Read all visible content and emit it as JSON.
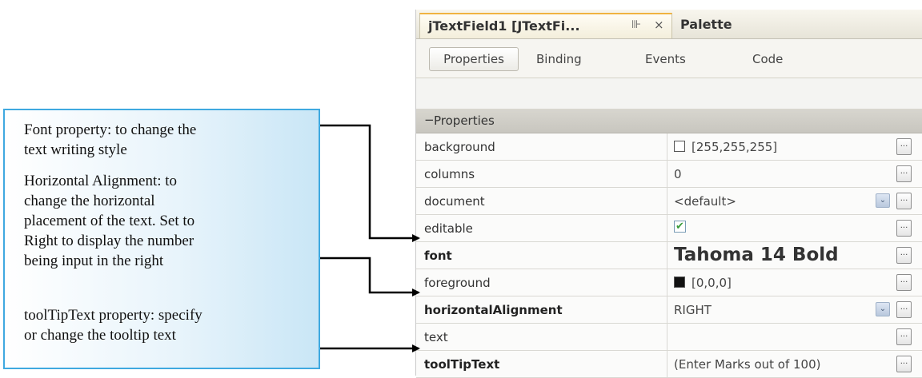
{
  "callout": {
    "p1_l1": "Font property: to change the",
    "p1_l2": "text writing style",
    "p2_l1": "Horizontal Alignment: to",
    "p2_l2": "change the horizontal",
    "p2_l3": "placement of the text. Set to",
    "p2_l4": "Right to display the number",
    "p2_l5": "being input in the right",
    "p3_l1": "toolTipText property: specify",
    "p3_l2": "or change the tooltip text"
  },
  "tabbar": {
    "active_title": "jTextField1 [JTextFi...",
    "pin_icon": "⊪",
    "close_icon": "×",
    "palette_label": "Palette"
  },
  "subtabs": {
    "properties": "Properties",
    "binding": "Binding",
    "events": "Events",
    "code": "Code"
  },
  "section": {
    "toggle": "−",
    "title": "Properties"
  },
  "rows": [
    {
      "name": "background",
      "value": "[255,255,255]"
    },
    {
      "name": "columns",
      "value": "0"
    },
    {
      "name": "document",
      "value": "<default>"
    },
    {
      "name": "editable",
      "value": "✔"
    },
    {
      "name": "font",
      "value": "Tahoma 14 Bold"
    },
    {
      "name": "foreground",
      "value": "[0,0,0]"
    },
    {
      "name": "horizontalAlignment",
      "value": "RIGHT"
    },
    {
      "name": "text",
      "value": ""
    },
    {
      "name": "toolTipText",
      "value": "(Enter Marks out of 100)"
    }
  ],
  "ellipsis": "...",
  "combo_arrow": "⌄",
  "colors": {
    "callout_border": "#3fa9e0",
    "swatch_white": "#ffffff",
    "swatch_black": "#111111",
    "tab_accent": "#f0b341"
  }
}
